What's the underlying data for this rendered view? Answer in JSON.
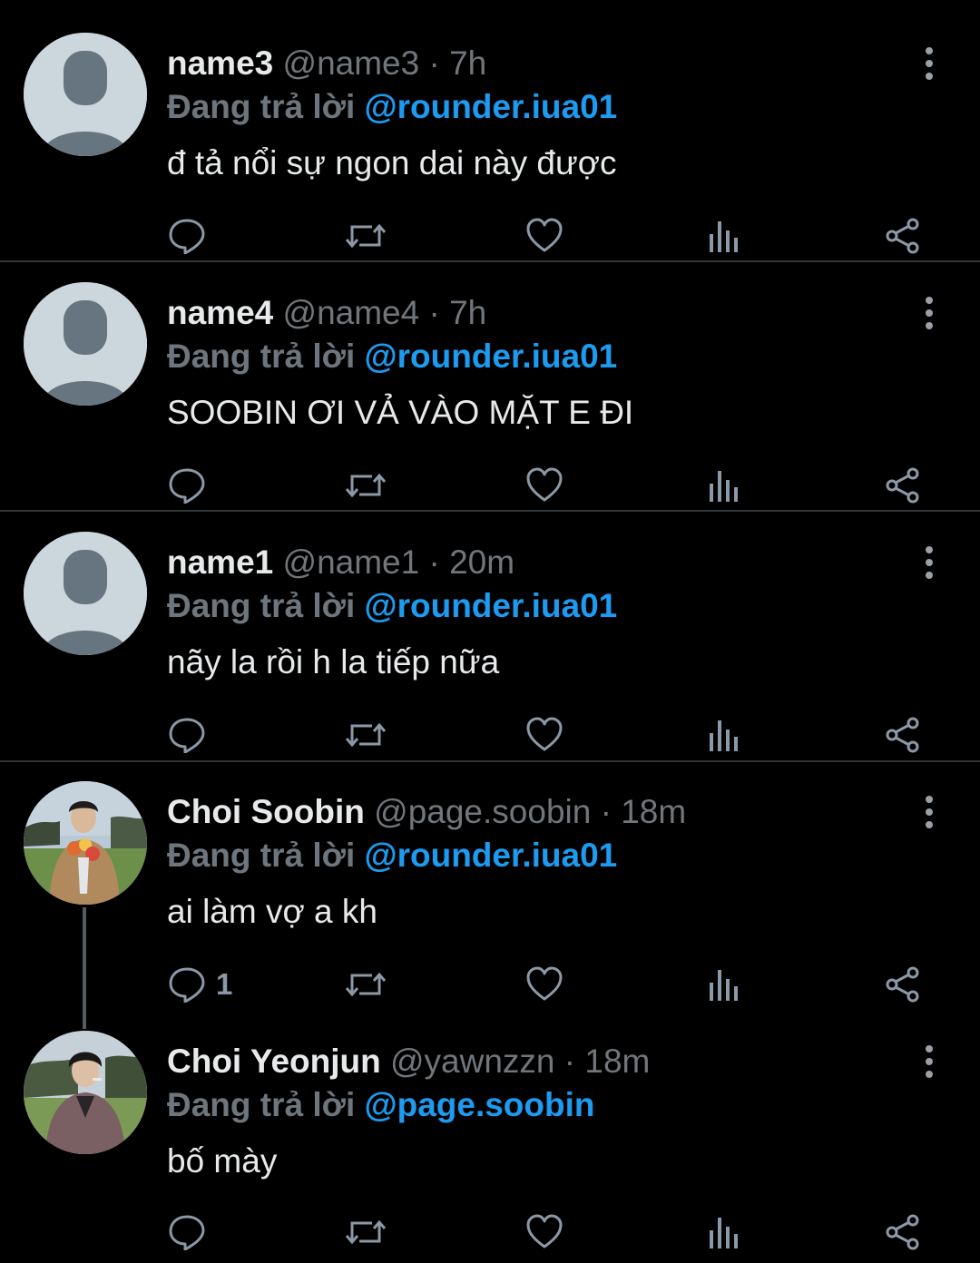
{
  "reply_prefix": "Đang trả lời",
  "colors": {
    "background": "#000000",
    "link": "#1d9bf0",
    "muted": "#71767b",
    "thread_line": "#555a5f"
  },
  "icons": {
    "reply": "comment-bubble-icon",
    "retweet": "retweet-arrows-icon",
    "like": "heart-icon",
    "views": "bar-chart-icon",
    "share": "share-icon",
    "more": "vertical-dots-icon"
  },
  "tweets": [
    {
      "name": "name3",
      "handle": "@name3",
      "dot": "·",
      "time": "7h",
      "reply_to": "@rounder.iua01",
      "text": "đ tả nổi sự ngon dai này được",
      "reply_count": "",
      "avatar": "default"
    },
    {
      "name": "name4",
      "handle": "@name4",
      "dot": "·",
      "time": "7h",
      "reply_to": "@rounder.iua01",
      "text": "SOOBIN ƠI VẢ VÀO MẶT E ĐI",
      "reply_count": "",
      "avatar": "default"
    },
    {
      "name": "name1",
      "handle": "@name1",
      "dot": "·",
      "time": "20m",
      "reply_to": "@rounder.iua01",
      "text": "nãy la rồi h la tiếp nữa",
      "reply_count": "",
      "avatar": "default"
    },
    {
      "name": "Choi Soobin",
      "handle": "@page.soobin",
      "dot": "·",
      "time": "18m",
      "reply_to": "@rounder.iua01",
      "text": "ai làm vợ a kh",
      "reply_count": "1",
      "avatar": "photo"
    },
    {
      "name": "Choi Yeonjun",
      "handle": "@yawnzzn",
      "dot": "·",
      "time": "18m",
      "reply_to": "@page.soobin",
      "text": "bố mày",
      "reply_count": "",
      "avatar": "photo"
    }
  ]
}
